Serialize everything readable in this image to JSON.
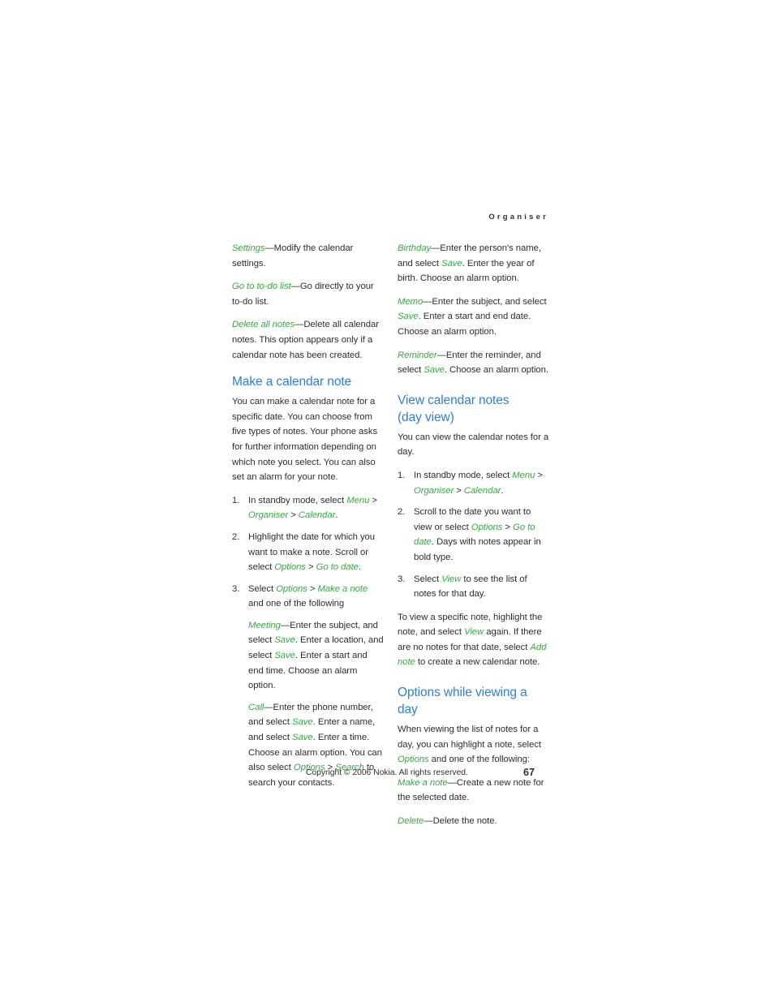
{
  "page": {
    "running_head": "Organiser",
    "page_number": "67",
    "copyright": "Copyright © 2006 Nokia. All rights reserved.",
    "colors": {
      "heading_blue": "#2b7de8",
      "ui_term_green": "#35ab3f",
      "body_text": "#2e2e2e",
      "background": "#ffffff"
    }
  },
  "left_column": {
    "options_continued": [
      {
        "term": "Settings",
        "dash": "—",
        "text": "Modify the calendar settings."
      },
      {
        "term": "Go to to-do list",
        "dash": "—",
        "text": "Go directly to your to-do list."
      },
      {
        "term": "Delete all notes",
        "dash": "—",
        "text": "Delete all calendar notes. This option appears only if a calendar note has been created."
      }
    ],
    "section": {
      "heading": "Make a calendar note",
      "intro": "You can make a calendar note for a specific date. You can choose from five types of notes. Your phone asks for further information depending on which note you select. You can also set an alarm for your note.",
      "steps": [
        {
          "num": "1.",
          "parts": [
            {
              "t": "In standby mode, select ",
              "k": "plain"
            },
            {
              "t": "Menu",
              "k": "ui"
            },
            {
              "t": " > ",
              "k": "plain"
            },
            {
              "t": "Organiser",
              "k": "ui"
            },
            {
              "t": " > ",
              "k": "plain"
            },
            {
              "t": "Calendar",
              "k": "ui"
            },
            {
              "t": ".",
              "k": "plain"
            }
          ]
        },
        {
          "num": "2.",
          "parts": [
            {
              "t": "Highlight the date for which you want to make a note. Scroll or select ",
              "k": "plain"
            },
            {
              "t": "Options",
              "k": "ui"
            },
            {
              "t": " > ",
              "k": "plain"
            },
            {
              "t": "Go to date",
              "k": "ui"
            },
            {
              "t": ".",
              "k": "plain"
            }
          ]
        },
        {
          "num": "3.",
          "parts": [
            {
              "t": "Select ",
              "k": "plain"
            },
            {
              "t": "Options",
              "k": "ui"
            },
            {
              "t": " > ",
              "k": "plain"
            },
            {
              "t": "Make a note",
              "k": "ui"
            },
            {
              "t": " and one of the following",
              "k": "plain"
            }
          ],
          "subitems": [
            {
              "parts": [
                {
                  "t": "Meeting",
                  "k": "ui"
                },
                {
                  "t": "—Enter the subject, and select ",
                  "k": "plain"
                },
                {
                  "t": "Save",
                  "k": "ui"
                },
                {
                  "t": ". Enter a location, and select ",
                  "k": "plain"
                },
                {
                  "t": "Save",
                  "k": "ui"
                },
                {
                  "t": ". Enter a start and end time. Choose an alarm option.",
                  "k": "plain"
                }
              ]
            },
            {
              "parts": [
                {
                  "t": "Call",
                  "k": "ui"
                },
                {
                  "t": "—Enter the phone number, and select ",
                  "k": "plain"
                },
                {
                  "t": "Save",
                  "k": "ui"
                },
                {
                  "t": ". Enter a name, and select ",
                  "k": "plain"
                },
                {
                  "t": "Save",
                  "k": "ui"
                },
                {
                  "t": ". Enter a time. Choose an alarm option. You can also select ",
                  "k": "plain"
                },
                {
                  "t": "Options",
                  "k": "ui"
                },
                {
                  "t": " > ",
                  "k": "plain"
                },
                {
                  "t": "Search",
                  "k": "ui"
                },
                {
                  "t": " to search your contacts.",
                  "k": "plain"
                }
              ]
            }
          ]
        }
      ]
    }
  },
  "right_column": {
    "note_types": [
      {
        "parts": [
          {
            "t": "Birthday",
            "k": "ui"
          },
          {
            "t": "—Enter the person's name, and select ",
            "k": "plain"
          },
          {
            "t": "Save",
            "k": "ui"
          },
          {
            "t": ". Enter the year of birth. Choose an alarm option.",
            "k": "plain"
          }
        ]
      },
      {
        "parts": [
          {
            "t": "Memo",
            "k": "ui"
          },
          {
            "t": "—Enter the subject, and select ",
            "k": "plain"
          },
          {
            "t": "Save",
            "k": "ui"
          },
          {
            "t": ". Enter a start and end date. Choose an alarm option.",
            "k": "plain"
          }
        ]
      },
      {
        "parts": [
          {
            "t": "Reminder",
            "k": "ui"
          },
          {
            "t": "—Enter the reminder, and select ",
            "k": "plain"
          },
          {
            "t": "Save",
            "k": "ui"
          },
          {
            "t": ". Choose an alarm option.",
            "k": "plain"
          }
        ]
      }
    ],
    "view_section": {
      "heading_line1": "View calendar notes",
      "heading_line2": "(day view)",
      "intro": "You can view the calendar notes for a day.",
      "steps": [
        {
          "num": "1.",
          "parts": [
            {
              "t": "In standby mode, select ",
              "k": "plain"
            },
            {
              "t": "Menu",
              "k": "ui"
            },
            {
              "t": " > ",
              "k": "plain"
            },
            {
              "t": "Organiser",
              "k": "ui"
            },
            {
              "t": " > ",
              "k": "plain"
            },
            {
              "t": "Calendar",
              "k": "ui"
            },
            {
              "t": ".",
              "k": "plain"
            }
          ]
        },
        {
          "num": "2.",
          "parts": [
            {
              "t": "Scroll to the date you want to view or select ",
              "k": "plain"
            },
            {
              "t": "Options",
              "k": "ui"
            },
            {
              "t": " > ",
              "k": "plain"
            },
            {
              "t": "Go to date",
              "k": "ui"
            },
            {
              "t": ". Days with notes appear in bold type.",
              "k": "plain"
            }
          ]
        },
        {
          "num": "3.",
          "parts": [
            {
              "t": "Select ",
              "k": "plain"
            },
            {
              "t": "View",
              "k": "ui"
            },
            {
              "t": " to see the list of notes for that day.",
              "k": "plain"
            }
          ]
        }
      ],
      "closing": {
        "parts": [
          {
            "t": "To view a specific note, highlight the note, and select ",
            "k": "plain"
          },
          {
            "t": "View",
            "k": "ui"
          },
          {
            "t": " again. If there are no notes for that date, select ",
            "k": "plain"
          },
          {
            "t": "Add note",
            "k": "ui"
          },
          {
            "t": " to create a new calendar note.",
            "k": "plain"
          }
        ]
      }
    },
    "options_section": {
      "heading": "Options while viewing a day",
      "intro": {
        "parts": [
          {
            "t": "When viewing the list of notes for a day, you can highlight a note, select ",
            "k": "plain"
          },
          {
            "t": "Options",
            "k": "ui"
          },
          {
            "t": " and one of the following:",
            "k": "plain"
          }
        ]
      },
      "items": [
        {
          "parts": [
            {
              "t": "Make a note",
              "k": "ui"
            },
            {
              "t": "—Create a new note for the selected date.",
              "k": "plain"
            }
          ]
        },
        {
          "parts": [
            {
              "t": "Delete",
              "k": "ui"
            },
            {
              "t": "—Delete the note.",
              "k": "plain"
            }
          ]
        }
      ]
    }
  }
}
